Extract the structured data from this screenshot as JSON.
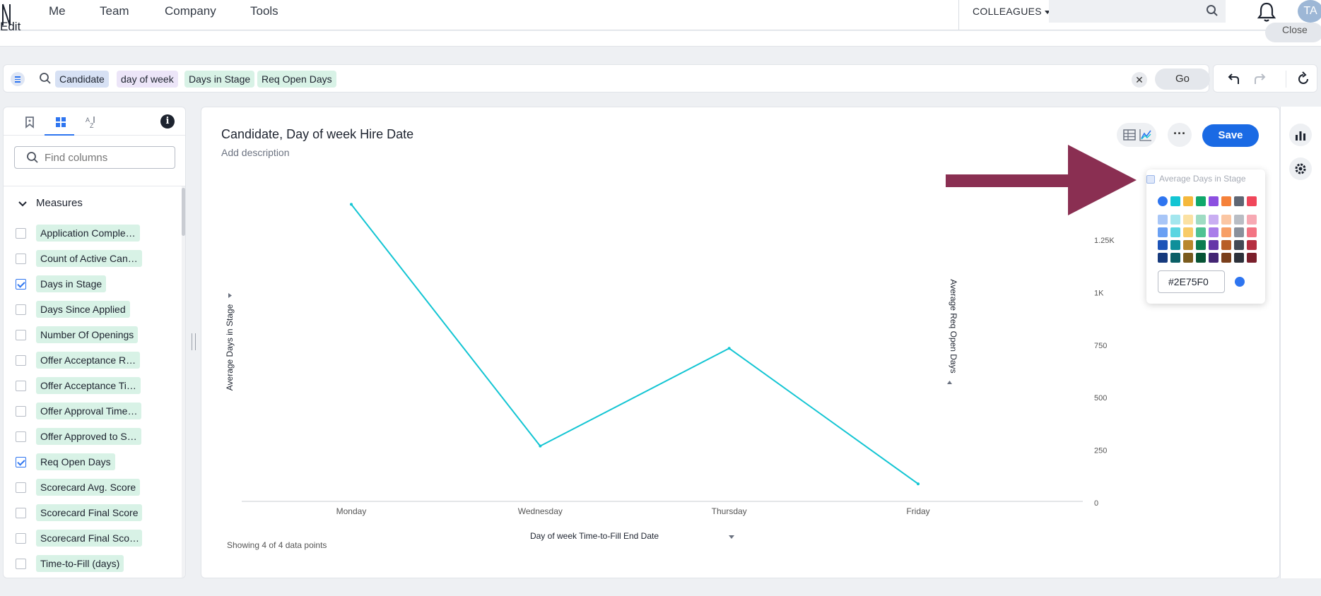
{
  "nav": {
    "items": [
      "Me",
      "Team",
      "Company",
      "Tools"
    ],
    "colleagues_label": "COLLEAGUES",
    "avatar_initials": "TA"
  },
  "page": {
    "edit_label": "Edit",
    "close_label": "Close"
  },
  "searchbar": {
    "chips": [
      {
        "label": "Candidate",
        "kind": "attribute"
      },
      {
        "label": "day of week",
        "kind": "keyword"
      },
      {
        "label": "Days in Stage",
        "kind": "measure"
      },
      {
        "label": "Req Open Days",
        "kind": "measure"
      }
    ],
    "go_label": "Go",
    "clear_glyph": "✕"
  },
  "leftpanel": {
    "find_placeholder": "Find columns",
    "info_glyph": "i",
    "measures_header": "Measures",
    "columns": [
      {
        "label": "Application Comple…",
        "checked": false
      },
      {
        "label": "Count of Active Can…",
        "checked": false
      },
      {
        "label": "Days in Stage",
        "checked": true
      },
      {
        "label": "Days Since Applied",
        "checked": false
      },
      {
        "label": "Number Of Openings",
        "checked": false
      },
      {
        "label": "Offer Acceptance R…",
        "checked": false
      },
      {
        "label": "Offer Acceptance Ti…",
        "checked": false
      },
      {
        "label": "Offer Approval Time…",
        "checked": false
      },
      {
        "label": "Offer Approved to S…",
        "checked": false
      },
      {
        "label": "Req Open Days",
        "checked": true
      },
      {
        "label": "Scorecard Avg. Score",
        "checked": false
      },
      {
        "label": "Scorecard Final Score",
        "checked": false
      },
      {
        "label": "Scorecard Final Sco…",
        "checked": false
      },
      {
        "label": "Time-to-Fill (days)",
        "checked": false
      }
    ]
  },
  "main": {
    "title": "Candidate, Day of week Hire Date",
    "description": "Add description",
    "save_label": "Save",
    "more_glyph": "···",
    "showing_text": "Showing 4 of 4 data points"
  },
  "chart_data": {
    "type": "line",
    "categories": [
      "Monday",
      "Wednesday",
      "Thursday",
      "Friday"
    ],
    "series": [
      {
        "name": "Average Req Open Days",
        "values": [
          1420,
          270,
          735,
          90
        ],
        "color": "#13c5d3",
        "axis": "right"
      }
    ],
    "xlabel": "Day of week Time-to-Fill End Date",
    "ylabel_left": "Average Days in Stage",
    "ylabel_right": "Average Req Open Days",
    "right_ticks": [
      {
        "value": 0,
        "label": "0"
      },
      {
        "value": 250,
        "label": "250"
      },
      {
        "value": 500,
        "label": "500"
      },
      {
        "value": 750,
        "label": "750"
      },
      {
        "value": 1000,
        "label": "1K"
      },
      {
        "value": 1250,
        "label": "1.25K"
      }
    ],
    "ylim": [
      0,
      1420
    ]
  },
  "colorpicker": {
    "series_label": "Average Days in Stage",
    "hex_value": "#2E75F0",
    "selected_color": "#2e75f0",
    "palette_top": [
      "#2e75f0",
      "#13c5d3",
      "#f5b83c",
      "#10a86b",
      "#8c4fe0",
      "#f5813a",
      "#5f6673",
      "#f0465a"
    ],
    "palette_rows": [
      [
        "#a8c6f7",
        "#a3e6ee",
        "#fbe1a3",
        "#9fdcc3",
        "#c9aef2",
        "#fbc6a3",
        "#b9bdc4",
        "#f7a9b3"
      ],
      [
        "#6aa0f3",
        "#5bd5e1",
        "#f8cb67",
        "#4fc293",
        "#a97de9",
        "#f79f67",
        "#8a909b",
        "#f37483"
      ],
      [
        "#1d54b8",
        "#0e8f9a",
        "#b8882b",
        "#0b7d50",
        "#6536a8",
        "#b85e28",
        "#434955",
        "#b52f40"
      ],
      [
        "#163a7d",
        "#0a5f66",
        "#7a5b1d",
        "#075435",
        "#432573",
        "#7a3f1b",
        "#2c313a",
        "#7a1f2b"
      ]
    ]
  },
  "colors": {
    "accent": "#2e75f0",
    "save": "#1a6ae4",
    "annotation_arrow": "#8a2f52",
    "line": "#13c5d3"
  }
}
